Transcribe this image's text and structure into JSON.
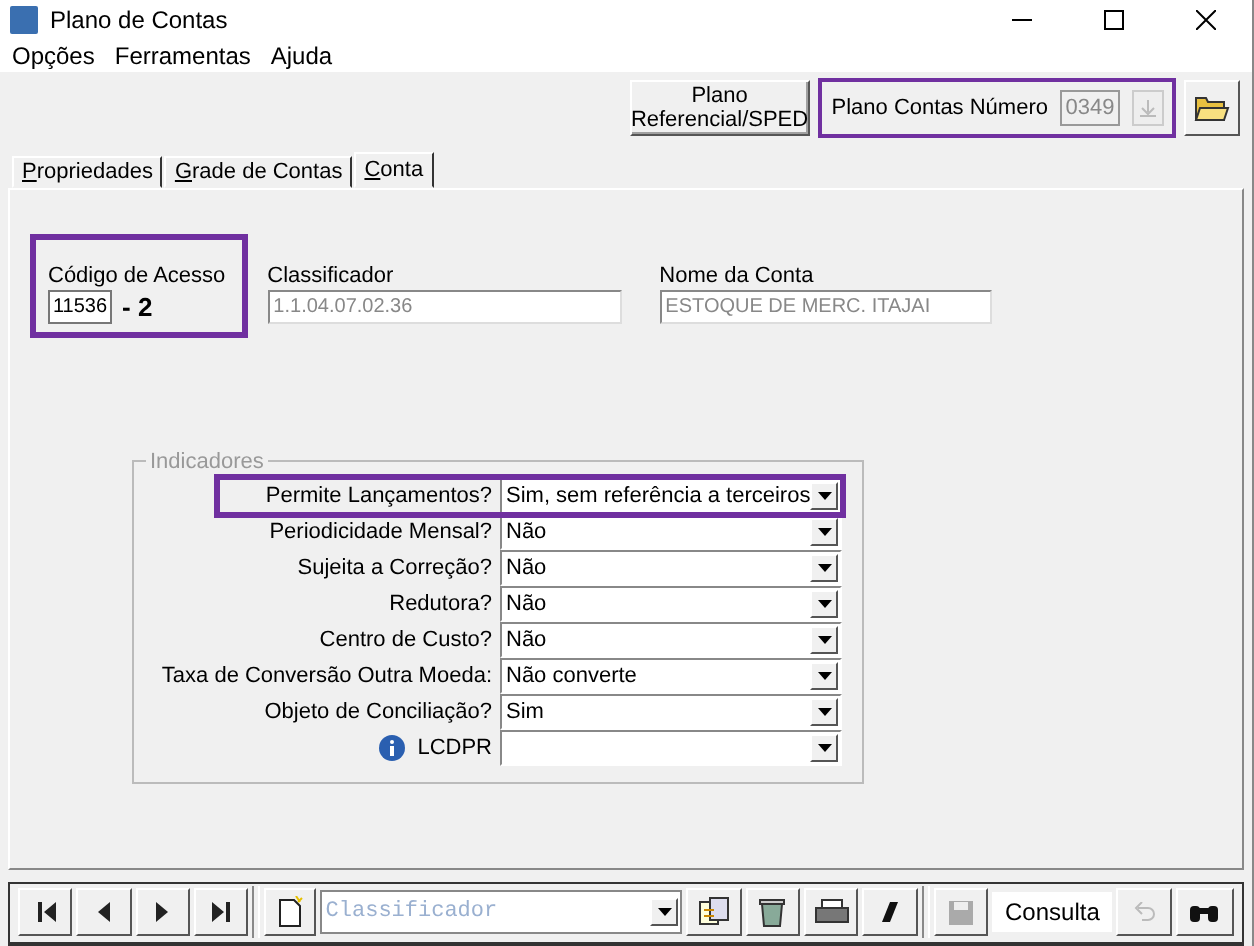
{
  "window": {
    "title": "Plano de Contas"
  },
  "menu": [
    "Opções",
    "Ferramentas",
    "Ajuda"
  ],
  "toolbar": {
    "sped_button": [
      "Plano",
      "Referencial/SPED"
    ],
    "plan_number": {
      "label": "Plano Contas Número",
      "value": "0349",
      "disabled": true,
      "highlighted": true
    }
  },
  "tabs": [
    {
      "label": "Propriedades",
      "selected": false
    },
    {
      "label": "Grade de Contas",
      "selected": false
    },
    {
      "label": "Conta",
      "selected": true
    }
  ],
  "account": {
    "code": {
      "label": "Código de Acesso",
      "value": "11536",
      "check_digit": "- 2",
      "highlighted": true
    },
    "classifier": {
      "label": "Classificador",
      "value": "1.1.04.07.02.36",
      "disabled": true
    },
    "name": {
      "label": "Nome da Conta",
      "value": "ESTOQUE DE MERC. ITAJAI",
      "disabled": true
    }
  },
  "indicators": {
    "title": "Indicadores",
    "rows": [
      {
        "kind": "plain",
        "label": "Permite Lançamentos?",
        "value": "Sim, sem referência a terceiros",
        "highlighted": true
      },
      {
        "kind": "plain",
        "label": "Periodicidade Mensal?",
        "value": "Não",
        "highlighted": false
      },
      {
        "kind": "plain",
        "label": "Sujeita a Correção?",
        "value": "Não",
        "highlighted": false
      },
      {
        "kind": "plain",
        "label": "Redutora?",
        "value": "Não",
        "highlighted": false
      },
      {
        "kind": "plain",
        "label": "Centro de Custo?",
        "value": "Não",
        "highlighted": false
      },
      {
        "kind": "plain",
        "label": "Taxa de Conversão Outra Moeda:",
        "value": "Não converte",
        "highlighted": false
      },
      {
        "kind": "plain",
        "label": "Objeto de Conciliação?",
        "value": "Sim",
        "highlighted": false
      },
      {
        "kind": "info",
        "label": "LCDPR",
        "value": "",
        "highlighted": false
      }
    ]
  },
  "bottom_bar": {
    "nav": [
      {
        "kind": "first"
      },
      {
        "kind": "prev"
      },
      {
        "kind": "next"
      },
      {
        "kind": "last"
      }
    ],
    "search_placeholder": "Classificador",
    "tools": [
      {
        "kind": "new"
      },
      {
        "kind": "copy"
      },
      {
        "kind": "delete"
      },
      {
        "kind": "print"
      },
      {
        "kind": "italic"
      }
    ],
    "save_disabled": true,
    "status": "Consulta",
    "undo_disabled": true
  }
}
